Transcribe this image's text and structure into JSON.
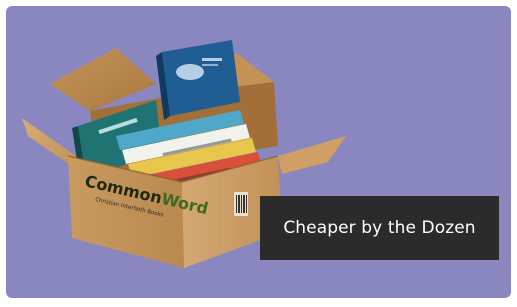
{
  "image": {
    "background_color": "#8a86bf",
    "caption_background": "#2c2b2b",
    "box_color": "#c69a61",
    "box_brand": "CommonWord",
    "box_tagline": "Christian Interfaith Books",
    "icon": "box-of-books-icon"
  },
  "caption": {
    "text": "Cheaper by the Dozen"
  }
}
